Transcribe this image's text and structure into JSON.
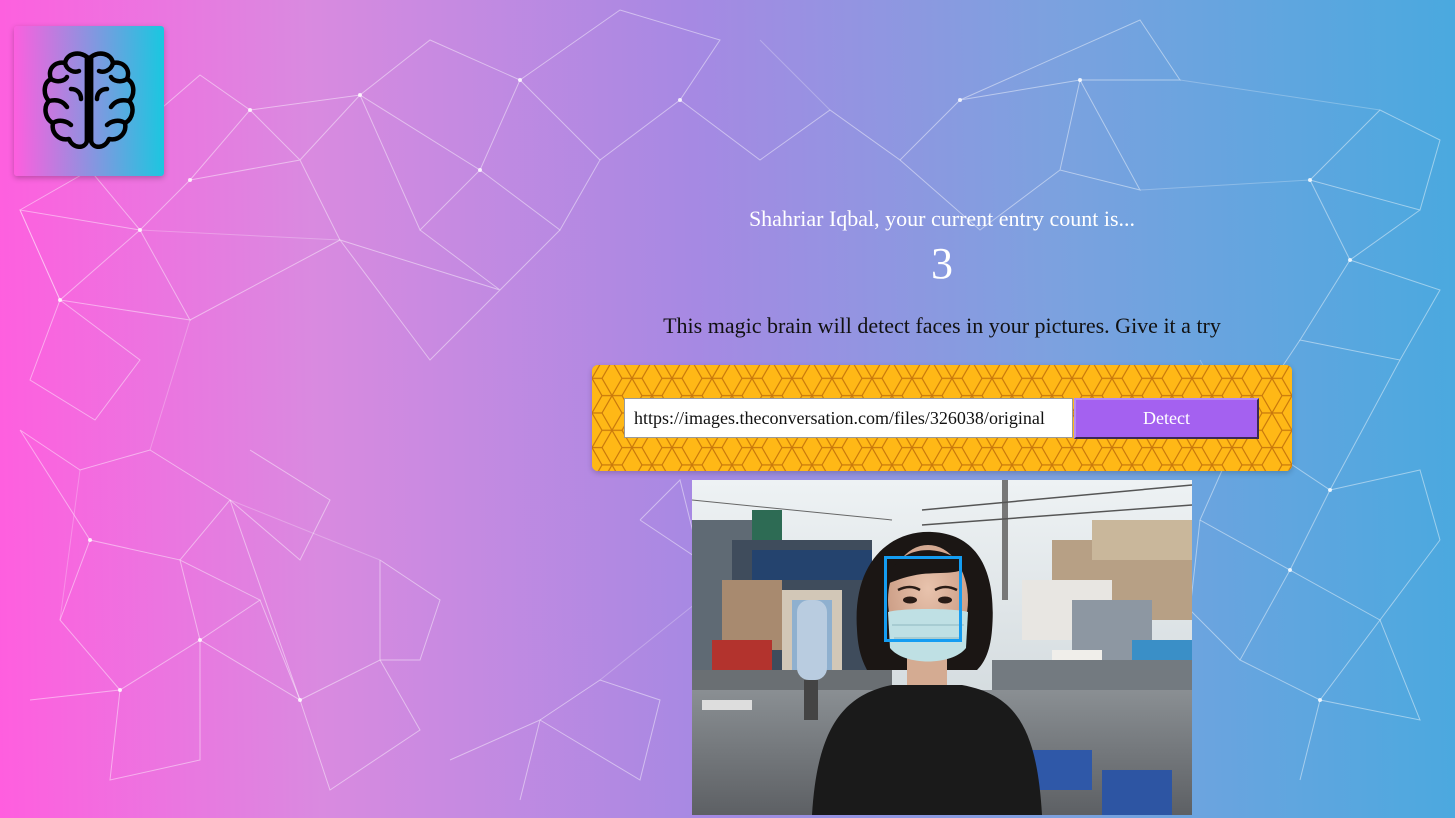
{
  "app": {
    "logo_icon": "brain-icon"
  },
  "rank": {
    "greeting": "Shahriar Iqbal, your current entry count is...",
    "count": "3"
  },
  "intro": {
    "tagline": "This magic brain will detect faces in your pictures. Give it a try"
  },
  "form": {
    "url_value": "https://images.theconversation.com/files/326038/original",
    "detect_label": "Detect"
  },
  "result": {
    "face_box_icon": "face-bounding-box",
    "image_alt": "woman wearing face mask"
  },
  "colors": {
    "gradient_left": "#ff5edf",
    "gradient_right": "#4aa9df",
    "panel": "#ffb816",
    "button": "#a461f0",
    "face_box": "#149df2"
  }
}
